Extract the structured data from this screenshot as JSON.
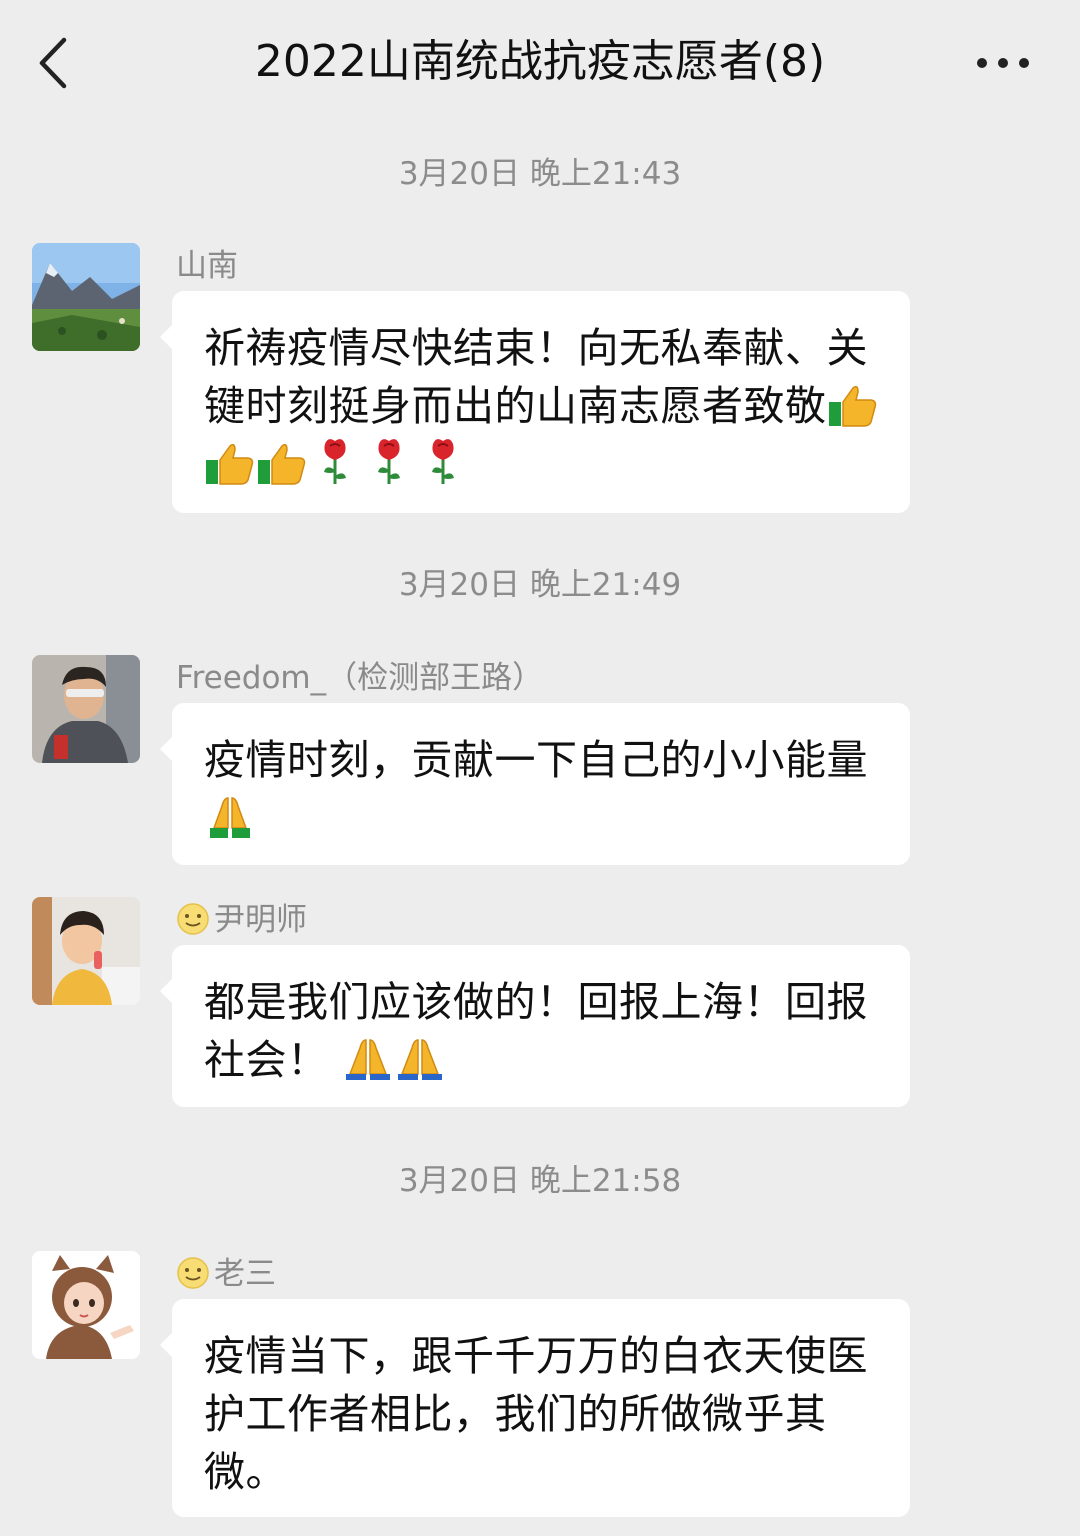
{
  "header": {
    "title": "2022山南统战抗疫志愿者(8)",
    "back_icon": "chevron-left-icon",
    "more_icon": "ellipsis-icon"
  },
  "timestamps": [
    "3月20日 晚上21:43",
    "3月20日 晚上21:49",
    "3月20日 晚上21:58"
  ],
  "messages": [
    {
      "sender": "山南",
      "text": "祈祷疫情尽快结束！向无私奉献、关键时刻挺身而出的山南志愿者致敬",
      "emojis": [
        "thumbs-up",
        "thumbs-up",
        "thumbs-up",
        "rose",
        "rose",
        "rose"
      ]
    },
    {
      "sender": "Freedom_（检测部王路）",
      "text": "疫情时刻，贡献一下自己的小小能量",
      "emojis": [
        "pray"
      ]
    },
    {
      "sender": "尹明师",
      "sender_emoji": "smiley",
      "text": "都是我们应该做的！回报上海！回报社会！",
      "emojis": [
        "pray",
        "pray"
      ]
    },
    {
      "sender": "老三",
      "sender_emoji": "smiley",
      "text": "疫情当下，跟千千万万的白衣天使医护工作者相比，我们的所做微乎其微。",
      "emojis": []
    }
  ],
  "colors": {
    "background": "#ededed",
    "bubble": "#ffffff",
    "timestamp": "#8c8c8c",
    "sender": "#8a8a8a"
  }
}
